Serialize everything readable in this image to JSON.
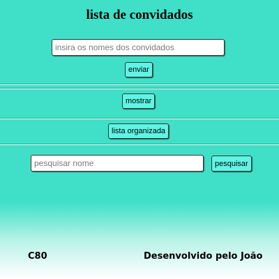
{
  "page": {
    "title": "lista de convidados"
  },
  "guest_form": {
    "input_placeholder": "insira os nomes dos convidados",
    "input_value": "",
    "submit_label": "enviar"
  },
  "show_section": {
    "button_label": "mostrar"
  },
  "sort_section": {
    "button_label": "lista organizada"
  },
  "search_section": {
    "input_placeholder": "pesquisar nome",
    "input_value": "",
    "button_label": "pesquisar"
  },
  "footer": {
    "left_text": "C80",
    "right_text": "Desenvolvido pelo João"
  },
  "colors": {
    "background": "#40e0c8",
    "button": "#5ff5e5"
  }
}
